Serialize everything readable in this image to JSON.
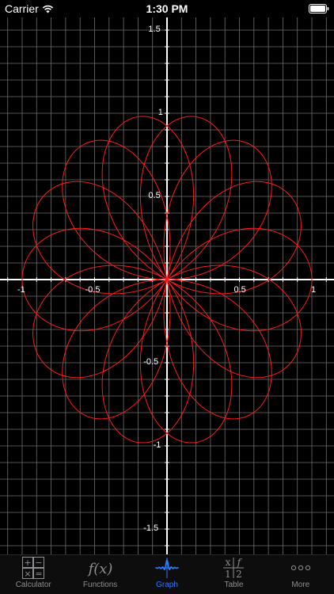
{
  "status_bar": {
    "carrier": "Carrier",
    "time": "1:30 PM",
    "wifi_icon": "wifi-icon",
    "battery_icon": "battery-icon"
  },
  "graph": {
    "background": "#000000",
    "grid_color": "#6e6e6e",
    "axis_color": "#ffffff",
    "curve_color": "#ff1a1a",
    "x_range": [
      -1.1,
      1.1
    ],
    "y_range": [
      -1.66,
      1.66
    ],
    "curve": {
      "type": "polar_rose",
      "formula": "r = sin(7θ/4)",
      "amplitude": 1,
      "petal_k": 1.75,
      "theta_max_turns": 4
    },
    "x_ticks": [
      {
        "value": -1,
        "label": "-1"
      },
      {
        "value": -0.5,
        "label": "-0.5"
      },
      {
        "value": 0.5,
        "label": "0.5"
      },
      {
        "value": 1,
        "label": "1"
      }
    ],
    "y_ticks": [
      {
        "value": 1.5,
        "label": "1.5"
      },
      {
        "value": 1,
        "label": "1"
      },
      {
        "value": 0.5,
        "label": "0.5"
      },
      {
        "value": -0.5,
        "label": "-0.5"
      },
      {
        "value": -1,
        "label": "-1"
      },
      {
        "value": -1.5,
        "label": "-1.5"
      }
    ]
  },
  "tab_bar": {
    "active_color": "#2f7bff",
    "inactive_color": "#8e8e93",
    "tabs": [
      {
        "label": "Calculator",
        "icon": "calculator-icon",
        "active": false
      },
      {
        "label": "Functions",
        "icon": "function-icon",
        "active": false
      },
      {
        "label": "Graph",
        "icon": "graph-wave-icon",
        "active": true
      },
      {
        "label": "Table",
        "icon": "table-icon",
        "active": false
      },
      {
        "label": "More",
        "icon": "more-dots-icon",
        "active": false
      }
    ],
    "calculator_icon_symbols": [
      "+",
      "−",
      "×",
      "="
    ],
    "function_icon_text": "f(x)",
    "table_icon_text": {
      "x": "x",
      "f": "f",
      "one": "1",
      "two": "2"
    },
    "more_icon_text": "ooo"
  }
}
